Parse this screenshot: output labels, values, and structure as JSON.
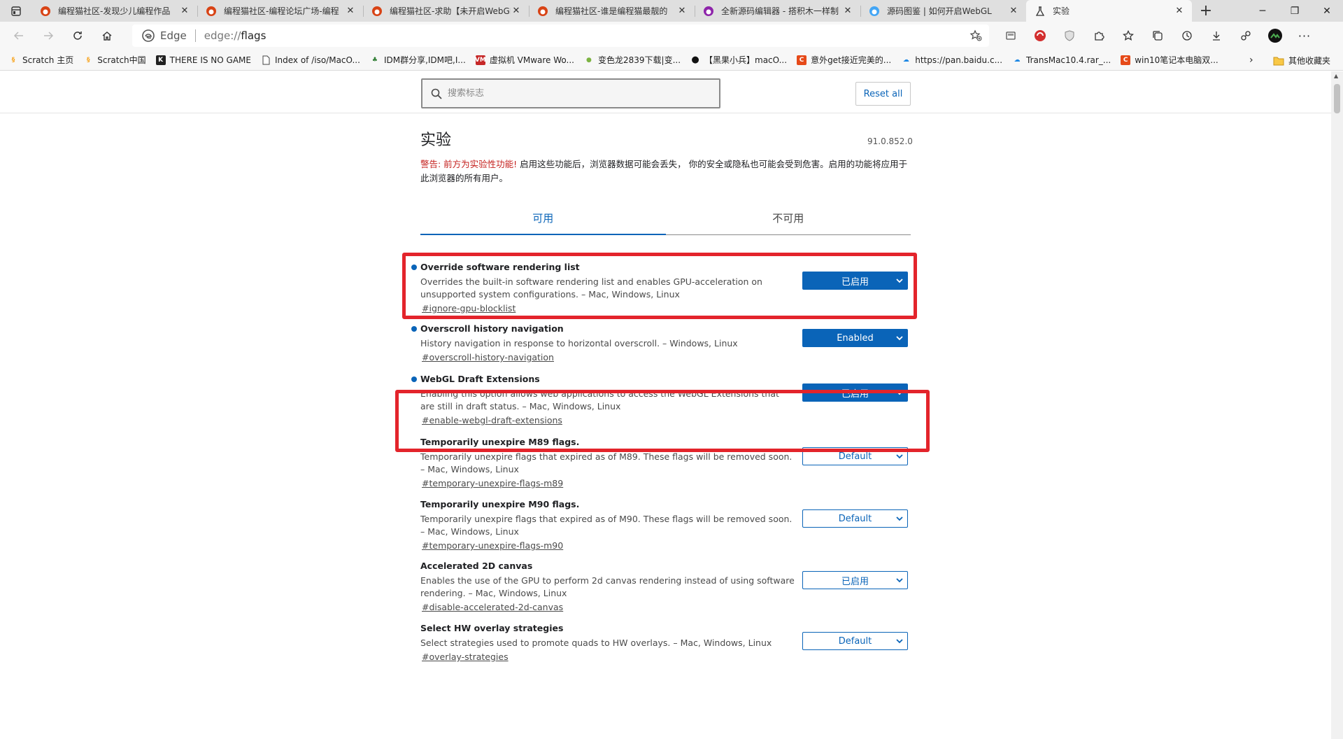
{
  "browser": {
    "tabs": [
      {
        "title": "编程猫社区-发现少儿编程作品",
        "active": false
      },
      {
        "title": "编程猫社区-编程论坛广场-编程",
        "active": false
      },
      {
        "title": "编程猫社区-求助【未开启WebGL",
        "active": false
      },
      {
        "title": "编程猫社区-谁是编程猫最靓的",
        "active": false
      },
      {
        "title": "全新源码编辑器 - 搭积木一样制",
        "active": false
      },
      {
        "title": "源码图鉴 | 如何开启WebGL",
        "active": false
      },
      {
        "title": "实验",
        "active": true
      }
    ],
    "address": {
      "brand": "Edge",
      "scheme": "edge://",
      "path": "flags"
    },
    "bookmarks": [
      {
        "label": "Scratch 主页",
        "color": "#f7a31c",
        "glyph": "§"
      },
      {
        "label": "Scratch中国",
        "color": "#f7a31c",
        "glyph": "§"
      },
      {
        "label": "THERE IS NO GAME",
        "color": "#222222",
        "glyph": "K"
      },
      {
        "label": "Index of /iso/MacO...",
        "color": "#ffffff",
        "glyph": ""
      },
      {
        "label": "IDM群分享,IDM吧,I...",
        "color": "#2e7d32",
        "glyph": "♣"
      },
      {
        "label": "虚拟机 VMware Wo...",
        "color": "#c62828",
        "glyph": "VM"
      },
      {
        "label": "变色龙2839下载|变...",
        "color": "#7cb342",
        "glyph": "●"
      },
      {
        "label": "【黑果小兵】macO...",
        "color": "#111111",
        "glyph": ""
      },
      {
        "label": "意外get接近完美的...",
        "color": "#e64a19",
        "glyph": "C"
      },
      {
        "label": "https://pan.baidu.c...",
        "color": "#1e88e5",
        "glyph": "☁"
      },
      {
        "label": "TransMac10.4.rar_...",
        "color": "#1e88e5",
        "glyph": "☁"
      },
      {
        "label": "win10笔记本电脑双...",
        "color": "#e64a19",
        "glyph": "C"
      }
    ],
    "other_bookmarks": "其他收藏夹"
  },
  "search": {
    "placeholder": "搜索标志"
  },
  "reset_label": "Reset all",
  "page": {
    "title": "实验",
    "version": "91.0.852.0",
    "warning_red": "警告: 前方为实验性功能!",
    "warning_rest": " 启用这些功能后，浏览器数据可能会丢失， 你的安全或隐私也可能会受到危害。启用的功能将应用于 此浏览器的所有用户。",
    "tab_available": "可用",
    "tab_unavailable": "不可用"
  },
  "flags": [
    {
      "name": "Override software rendering list",
      "desc": "Overrides the built-in software rendering list and enables GPU-acceleration on unsupported system configurations. – Mac, Windows, Linux",
      "link": "#ignore-gpu-blocklist",
      "value": "已启用",
      "modified": true
    },
    {
      "name": "Overscroll history navigation",
      "desc": "History navigation in response to horizontal overscroll. – Windows, Linux",
      "link": "#overscroll-history-navigation",
      "value": "Enabled",
      "modified": true
    },
    {
      "name": "WebGL Draft Extensions",
      "desc": "Enabling this option allows web applications to access the WebGL Extensions that are still in draft status. – Mac, Windows, Linux",
      "link": "#enable-webgl-draft-extensions",
      "value": "已启用",
      "modified": true
    },
    {
      "name": "Temporarily unexpire M89 flags.",
      "desc": "Temporarily unexpire flags that expired as of M89. These flags will be removed soon. – Mac, Windows, Linux",
      "link": "#temporary-unexpire-flags-m89",
      "value": "Default",
      "modified": false
    },
    {
      "name": "Temporarily unexpire M90 flags.",
      "desc": "Temporarily unexpire flags that expired as of M90. These flags will be removed soon. – Mac, Windows, Linux",
      "link": "#temporary-unexpire-flags-m90",
      "value": "Default",
      "modified": false
    },
    {
      "name": "Accelerated 2D canvas",
      "desc": "Enables the use of the GPU to perform 2d canvas rendering instead of using software rendering. – Mac, Windows, Linux",
      "link": "#disable-accelerated-2d-canvas",
      "value": "已启用",
      "modified": false
    },
    {
      "name": "Select HW overlay strategies",
      "desc": "Select strategies used to promote quads to HW overlays. – Mac, Windows, Linux",
      "link": "#overlay-strategies",
      "value": "Default",
      "modified": false
    }
  ],
  "colors": {
    "accent": "#0a64b8",
    "highlight": "#e3242b"
  }
}
